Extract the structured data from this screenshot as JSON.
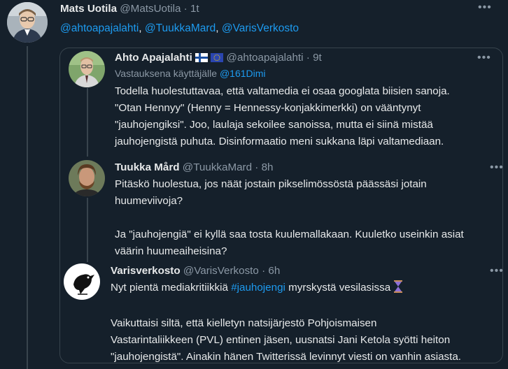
{
  "main_tweet": {
    "name": "Mats Uotila",
    "handle": "@MatsUotila",
    "sep": "·",
    "time": "1t",
    "mentions": [
      "@ahtoapajalahti",
      "@TuukkaMard",
      "@VarisVerkosto"
    ],
    "comma": ", "
  },
  "thread": [
    {
      "name": "Ahto Apajalahti",
      "badge_icons": [
        "finland-flag-icon",
        "eu-flag-icon"
      ],
      "handle": "@ahtoapajalahti",
      "sep": "·",
      "time": "9t",
      "reply_prefix": "Vastauksena käyttäjälle",
      "reply_to": "@161Dimi",
      "lines": [
        "Todella huolestuttavaa, että valtamedia ei osaa googlata biisien sanoja.",
        "\"Otan Hennyy\" (Henny = Hennessy-konjakkimerkki) on vääntynyt",
        "\"jauhojengiksi\". Joo, laulaja sekoilee sanoissa, mutta ei siinä mistää",
        "jauhojengistä puhuta. Disinformaatio meni sukkana läpi valtamediaan."
      ]
    },
    {
      "name": "Tuukka Mård",
      "handle": "@TuukkaMard",
      "sep": "·",
      "time": "8h",
      "lines": [
        "Pitäskö huolestua, jos näät jostain pikselimössöstä päässäsi jotain",
        "huumeviivoja?",
        "",
        "Ja \"jauhojengiä\" ei kyllä saa tosta kuulemallakaan. Kuuletko useinkin asiat",
        "väärin huumeaiheisina?"
      ]
    },
    {
      "name": "Varisverkosto",
      "handle": "@VarisVerkosto",
      "sep": "·",
      "time": "6h",
      "first_line_prefix": "Nyt pientä mediakritiikkiä",
      "hashtag": "#jauhojengi",
      "first_line_suffix": "myrskystä vesilasissa",
      "emoji_icon": "hourglass-icon",
      "lines": [
        "",
        "Vaikuttaisi siltä, että kielletyn natsijärjestö Pohjoismaisen",
        "Vastarintaliikkeen (PVL) entinen jäsen, uusnatsi Jani Ketola syötti heiton",
        "\"jauhojengistä\". Ainakin hänen Twitterissä levinnyt viesti on vanhin asiasta."
      ]
    }
  ],
  "more_icon": "•••",
  "colors": {
    "background": "#15202b",
    "text": "#e7e9ea",
    "muted": "#8b98a5",
    "link": "#1d9bf0",
    "border": "#38444d"
  }
}
